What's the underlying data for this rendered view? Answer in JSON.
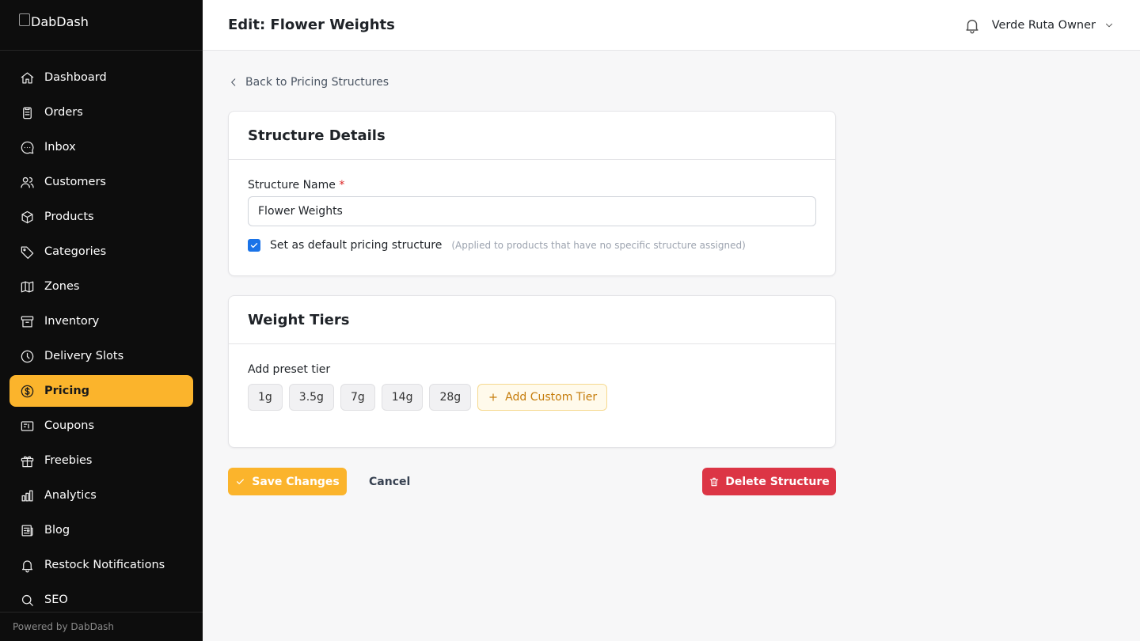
{
  "app": {
    "logo_alt": "DabDash",
    "footer": "Powered by DabDash"
  },
  "sidebar": {
    "items": [
      {
        "label": "Dashboard",
        "icon": "home-icon"
      },
      {
        "label": "Orders",
        "icon": "clipboard-icon"
      },
      {
        "label": "Inbox",
        "icon": "chat-icon"
      },
      {
        "label": "Customers",
        "icon": "users-icon"
      },
      {
        "label": "Products",
        "icon": "box-icon"
      },
      {
        "label": "Categories",
        "icon": "tag-icon"
      },
      {
        "label": "Zones",
        "icon": "map-icon"
      },
      {
        "label": "Inventory",
        "icon": "archive-icon"
      },
      {
        "label": "Delivery Slots",
        "icon": "clock-icon"
      },
      {
        "label": "Pricing",
        "icon": "dollar-icon",
        "active": true
      },
      {
        "label": "Coupons",
        "icon": "ticket-icon"
      },
      {
        "label": "Freebies",
        "icon": "gift-icon"
      },
      {
        "label": "Analytics",
        "icon": "bar-chart-icon"
      },
      {
        "label": "Blog",
        "icon": "newspaper-icon"
      },
      {
        "label": "Restock Notifications",
        "icon": "bell-icon"
      },
      {
        "label": "SEO",
        "icon": "search-icon"
      }
    ]
  },
  "header": {
    "title": "Edit: Flower Weights",
    "user_name": "Verde Ruta Owner"
  },
  "main": {
    "back_label": "Back to Pricing Structures",
    "details": {
      "title": "Structure Details",
      "name_label": "Structure Name",
      "name_required": "*",
      "name_value": "Flower Weights",
      "default_label": "Set as default pricing structure",
      "default_hint": "(Applied to products that have no specific structure assigned)",
      "default_checked": true
    },
    "tiers": {
      "title": "Weight Tiers",
      "preset_label": "Add preset tier",
      "presets": [
        "1g",
        "3.5g",
        "7g",
        "14g",
        "28g"
      ],
      "custom_label": "Add Custom Tier"
    },
    "actions": {
      "save": "Save Changes",
      "cancel": "Cancel",
      "delete": "Delete Structure"
    }
  },
  "colors": {
    "accent": "#fbb42c",
    "danger": "#dc3545",
    "sidebar_bg": "#0d0d0d",
    "checkbox": "#1a73e8"
  }
}
